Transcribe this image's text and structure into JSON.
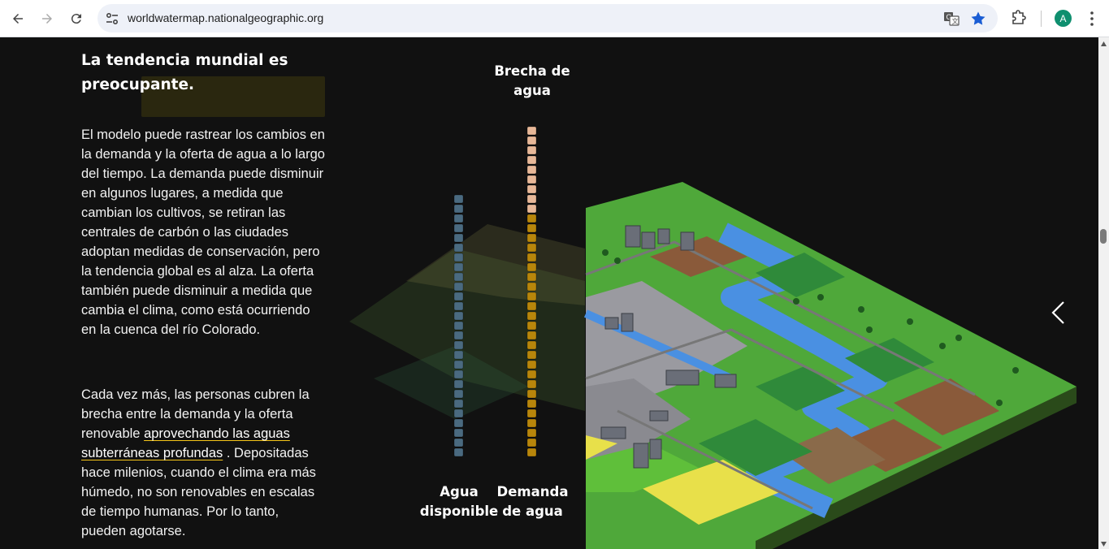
{
  "browser": {
    "url": "worldwatermap.nationalgeographic.org",
    "profile_initial": "A"
  },
  "article": {
    "heading": "La tendencia mundial es preocupante.",
    "paragraph1": "El modelo puede rastrear los cambios en la demanda y la oferta de agua a lo largo del tiempo. La demanda puede disminuir en algunos lugares, a medida que cambian los cultivos, se retiran las centrales de carbón o las ciudades adoptan medidas de conservación, pero la tendencia global es al alza. La oferta también puede disminuir a medida que cambia el clima, como está ocurriendo en la cuenca del río Colorado.",
    "paragraph2_before": "Cada vez más, las personas cubren la brecha entre la demanda y la oferta renovable ",
    "paragraph2_link": "aprovechando las aguas subterráneas profundas",
    "paragraph2_after": " . Depositadas hace milenios, cuando el clima era más húmedo, no son renovables en escalas de tiempo humanas. Por lo tanto, pueden agotarse."
  },
  "visual": {
    "gap_label": "Brecha de agua",
    "supply_label": "Agua disponible",
    "demand_label": "Demanda de agua",
    "supply_blocks": 27,
    "demand_blocks": 34,
    "gap_blocks": 9,
    "colors": {
      "supply": "#4a6a80",
      "demand": "#b8860b",
      "gap": "#e8b898",
      "river": "#4a90e2",
      "grass": "#5fbf3a",
      "field": "#e8e04a",
      "dark_field": "#2f8a3a"
    }
  }
}
